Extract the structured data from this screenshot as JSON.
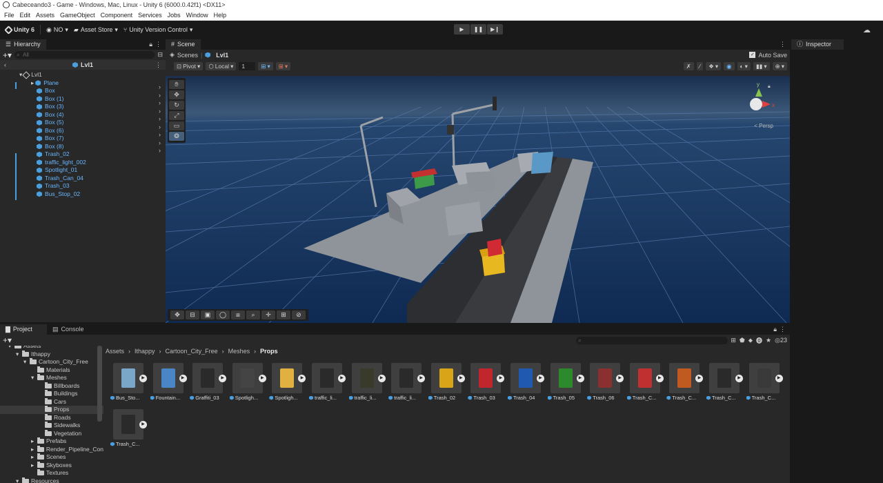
{
  "window": {
    "title": "Cabeceando3 - Game - Windows, Mac, Linux - Unity 6 (6000.0.42f1) <DX11>"
  },
  "menu": [
    "File",
    "Edit",
    "Assets",
    "GameObject",
    "Component",
    "Services",
    "Jobs",
    "Window",
    "Help"
  ],
  "toolbar": {
    "unity_label": "Unity 6",
    "account_label": "NO",
    "asset_store": "Asset Store",
    "version_control": "Unity Version Control"
  },
  "hierarchy": {
    "tab": "Hierarchy",
    "search_placeholder": "All",
    "scene": "Lvl1",
    "root": "Lvl1",
    "items": [
      "Plane",
      "Box",
      "Box (1)",
      "Box (3)",
      "Box (4)",
      "Box (5)",
      "Box (6)",
      "Box (7)",
      "Box (8)",
      "Trash_02",
      "traffic_light_002",
      "Spotlight_01",
      "Trash_Can_04",
      "Trash_03",
      "Bus_Stop_02"
    ]
  },
  "scene": {
    "tab": "Scene",
    "breadcrumb_root": "Scenes",
    "breadcrumb_scene": "Lvl1",
    "auto_save": "Auto Save",
    "pivot": "Pivot",
    "local": "Local",
    "grid_value": "1",
    "persp": "< Persp",
    "axis_y": "y",
    "axis_x": "x"
  },
  "inspector": {
    "tab": "Inspector"
  },
  "project": {
    "tab": "Project",
    "console_tab": "Console",
    "count": "23",
    "breadcrumb": [
      "Assets",
      "Ithappy",
      "Cartoon_City_Free",
      "Meshes",
      "Props"
    ],
    "tree": [
      {
        "label": "Assets",
        "indent": 0
      },
      {
        "label": "Ithappy",
        "indent": 1
      },
      {
        "label": "Cartoon_City_Free",
        "indent": 2
      },
      {
        "label": "Materials",
        "indent": 3
      },
      {
        "label": "Meshes",
        "indent": 3
      },
      {
        "label": "Billboards",
        "indent": 4
      },
      {
        "label": "Buildings",
        "indent": 4
      },
      {
        "label": "Cars",
        "indent": 4
      },
      {
        "label": "Props",
        "indent": 4
      },
      {
        "label": "Roads",
        "indent": 4
      },
      {
        "label": "Sidewalks",
        "indent": 4
      },
      {
        "label": "Vegetation",
        "indent": 4
      },
      {
        "label": "Prefabs",
        "indent": 3
      },
      {
        "label": "Render_Pipeline_Con",
        "indent": 3
      },
      {
        "label": "Scenes",
        "indent": 3
      },
      {
        "label": "Skyboxes",
        "indent": 3
      },
      {
        "label": "Textures",
        "indent": 3
      },
      {
        "label": "Resources",
        "indent": 1
      }
    ],
    "assets": [
      {
        "label": "Bus_Sto...",
        "color": "#7aa6c8"
      },
      {
        "label": "Fountain...",
        "color": "#4a86c6"
      },
      {
        "label": "Graffiti_03",
        "color": "#2a2a2a"
      },
      {
        "label": "Spotligh...",
        "color": "#444444"
      },
      {
        "label": "Spotligh...",
        "color": "#e0b040"
      },
      {
        "label": "traffic_li...",
        "color": "#2a2a2a"
      },
      {
        "label": "traffic_li...",
        "color": "#3a3a2a"
      },
      {
        "label": "traffic_li...",
        "color": "#2a2a2a"
      },
      {
        "label": "Trash_02",
        "color": "#d9a418"
      },
      {
        "label": "Trash_03",
        "color": "#c0262b"
      },
      {
        "label": "Trash_04",
        "color": "#1f5ab0"
      },
      {
        "label": "Trash_05",
        "color": "#2c8a2c"
      },
      {
        "label": "Trash_06",
        "color": "#8a3030"
      },
      {
        "label": "Trash_C...",
        "color": "#c03030"
      },
      {
        "label": "Trash_C...",
        "color": "#c05a20"
      },
      {
        "label": "Trash_C...",
        "color": "#2a2a2a"
      },
      {
        "label": "Trash_C...",
        "color": "#3a3a3a"
      },
      {
        "label": "Trash_C...",
        "color": "#2a2a2a"
      }
    ]
  }
}
